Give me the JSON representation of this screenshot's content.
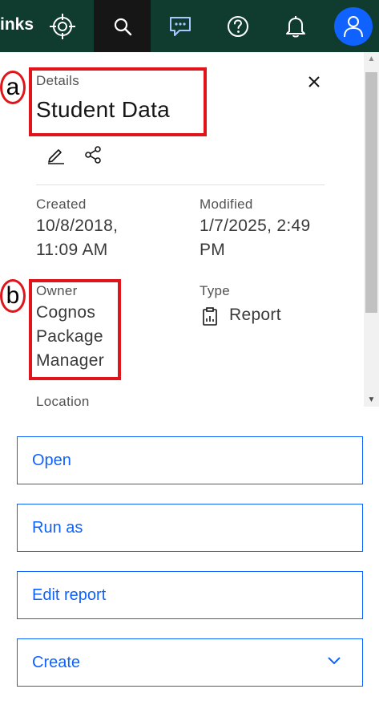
{
  "topbar": {
    "brand_fragment": "inks",
    "icons": [
      "target-icon",
      "search-icon",
      "chat-icon",
      "help-icon",
      "notification-icon",
      "user-avatar-icon"
    ]
  },
  "panel": {
    "section_label": "Details",
    "title": "Student Data",
    "created": {
      "label": "Created",
      "line1": "10/8/2018,",
      "line2": "11:09 AM"
    },
    "modified": {
      "label": "Modified",
      "line1": "1/7/2025, 2:49",
      "line2": "PM"
    },
    "owner": {
      "label": "Owner",
      "line1": "Cognos",
      "line2": "Package",
      "line3": "Manager"
    },
    "type": {
      "label": "Type",
      "value": "Report"
    },
    "location": {
      "label": "Location"
    }
  },
  "annotations": {
    "a": "a",
    "b": "b"
  },
  "buttons": {
    "open": "Open",
    "run_as": "Run as",
    "edit_report": "Edit report",
    "create": "Create"
  },
  "colors": {
    "topbar": "#103c2f",
    "accent": "#0f62fe",
    "annotation": "#e0151b"
  }
}
